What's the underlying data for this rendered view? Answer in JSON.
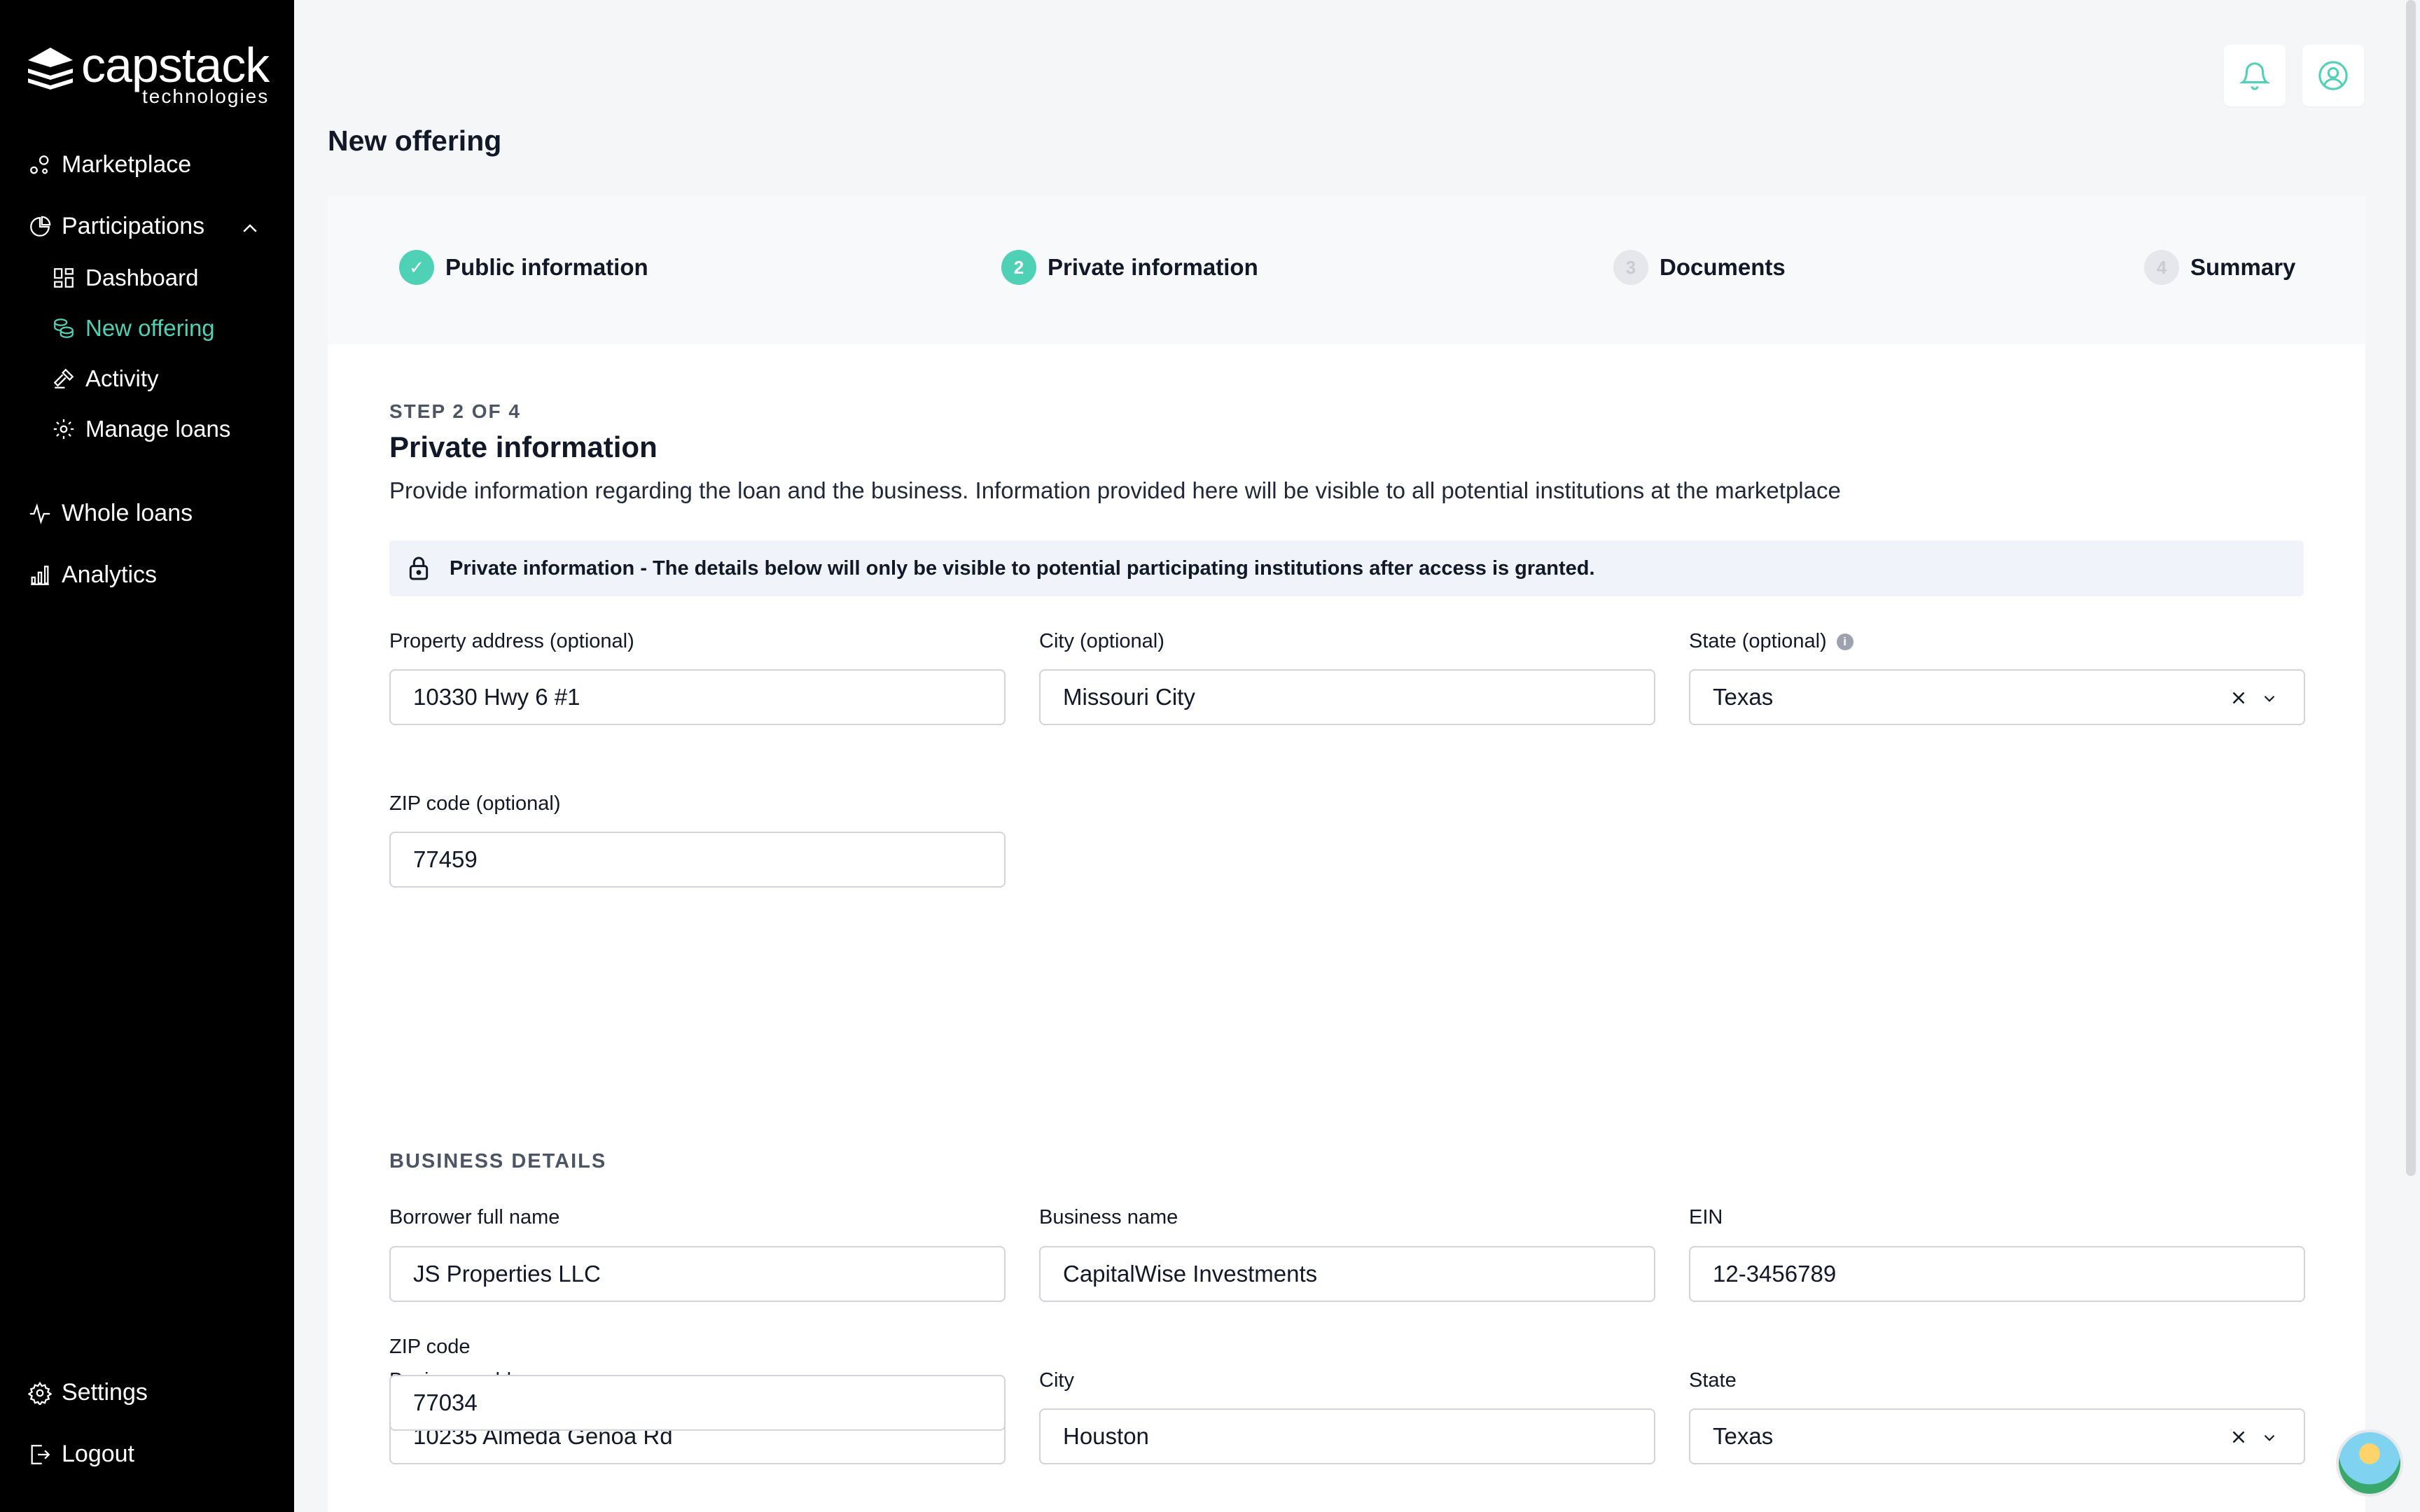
{
  "sidebar": {
    "logo": {
      "main": "capstack",
      "sub": "technologies"
    },
    "items": {
      "marketplace": "Marketplace",
      "participations": "Participations",
      "dashboard": "Dashboard",
      "new_offering": "New offering",
      "activity": "Activity",
      "manage_loans": "Manage loans",
      "whole_loans": "Whole loans",
      "analytics": "Analytics",
      "settings": "Settings",
      "logout": "Logout"
    }
  },
  "header": {
    "title": "New offering"
  },
  "stepper": {
    "steps": [
      {
        "label": "Public information",
        "marker": "✓",
        "status": "done"
      },
      {
        "label": "Private information",
        "marker": "2",
        "status": "current"
      },
      {
        "label": "Documents",
        "marker": "3",
        "status": "pending"
      },
      {
        "label": "Summary",
        "marker": "4",
        "status": "pending"
      }
    ]
  },
  "section": {
    "step_label": "STEP 2 OF 4",
    "title": "Private information",
    "description": "Provide information regarding the loan and the business. Information provided here will be visible to all potential institutions at the marketplace",
    "notice": "Private information - The details below will only be visible to potential participating institutions after access is granted."
  },
  "property": {
    "address_label": "Property address (optional)",
    "address_value": "10330 Hwy 6 #1",
    "city_label": "City (optional)",
    "city_value": "Missouri City",
    "state_label": "State (optional)",
    "state_value": "Texas",
    "zip_label": "ZIP code (optional)",
    "zip_value": "77459"
  },
  "business": {
    "heading": "BUSINESS DETAILS",
    "borrower_label": "Borrower full name",
    "borrower_value": "JS Properties LLC",
    "name_label": "Business name",
    "name_value": "CapitalWise Investments",
    "ein_label": "EIN",
    "ein_value": "12-3456789",
    "address_label": "Business address",
    "address_value": "10235 Almeda Genoa Rd",
    "city_label": "City",
    "city_value": "Houston",
    "state_label": "State",
    "state_value": "Texas",
    "zip_label": "ZIP code",
    "zip_value": "77034"
  },
  "colors": {
    "accent": "#4fd1b5",
    "sidebar": "#000000"
  }
}
